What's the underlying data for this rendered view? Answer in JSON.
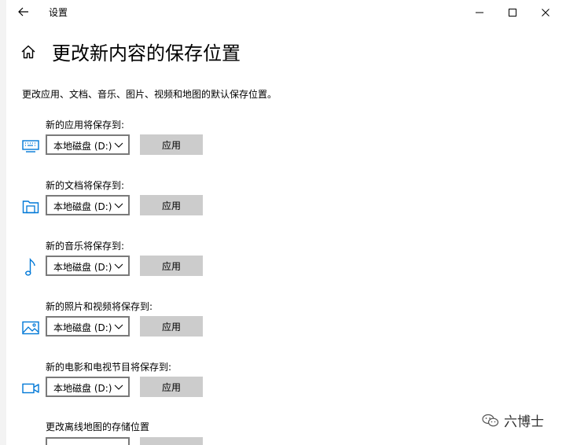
{
  "window": {
    "title": "设置"
  },
  "page": {
    "title": "更改新内容的保存位置",
    "intro": "更改应用、文档、音乐、图片、视频和地图的默认保存位置。"
  },
  "sections": [
    {
      "label": "新的应用将保存到:",
      "icon": "monitor-icon",
      "drive": "本地磁盘 (D:)",
      "apply_label": "应用"
    },
    {
      "label": "新的文档将保存到:",
      "icon": "folder-icon",
      "drive": "本地磁盘 (D:)",
      "apply_label": "应用"
    },
    {
      "label": "新的音乐将保存到:",
      "icon": "music-note-icon",
      "drive": "本地磁盘 (D:)",
      "apply_label": "应用"
    },
    {
      "label": "新的照片和视频将保存到:",
      "icon": "image-icon",
      "drive": "本地磁盘 (D:)",
      "apply_label": "应用"
    },
    {
      "label": "新的电影和电视节目将保存到:",
      "icon": "video-camera-icon",
      "drive": "本地磁盘 (D:)",
      "apply_label": "应用"
    }
  ],
  "offline_maps": {
    "label": "更改离线地图的存储位置"
  },
  "watermark": {
    "text": "六博士"
  },
  "colors": {
    "accent": "#0078d7",
    "button_bg": "#cccccc",
    "dropdown_border": "#7a7a7a"
  }
}
